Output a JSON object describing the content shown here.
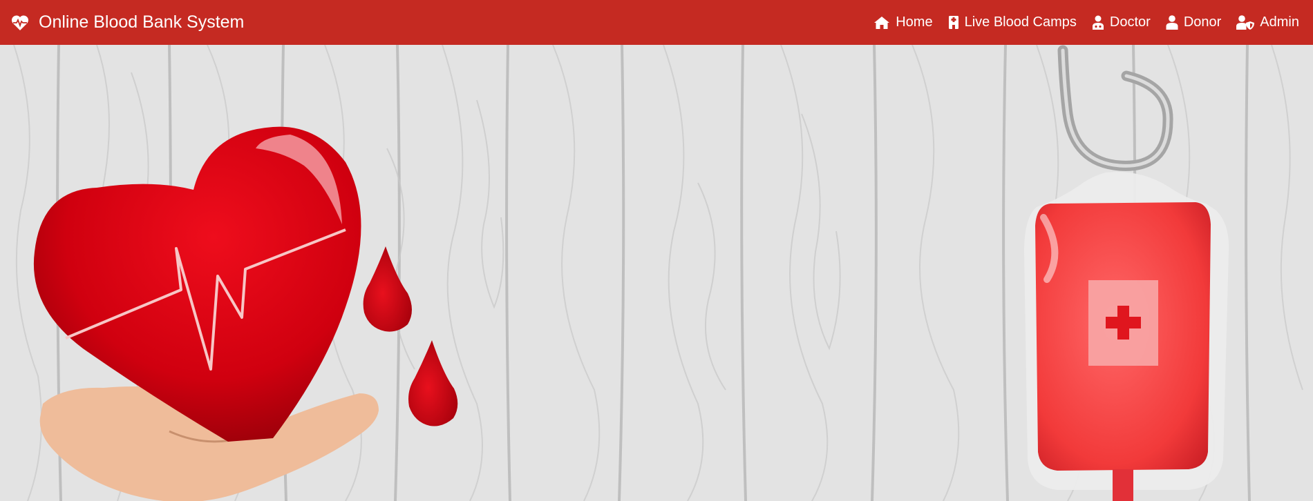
{
  "navbar": {
    "brand_icon": "heartbeat-icon",
    "brand_title": "Online Blood Bank System",
    "background_color": "#c52a22",
    "links": [
      {
        "label": "Home",
        "icon": "home-icon"
      },
      {
        "label": "Live Blood Camps",
        "icon": "hospital-icon"
      },
      {
        "label": "Doctor",
        "icon": "user-doctor-icon"
      },
      {
        "label": "Donor",
        "icon": "user-icon"
      },
      {
        "label": "Admin",
        "icon": "user-shield-icon"
      }
    ]
  },
  "hero": {
    "illustrations": [
      "heart-in-hand",
      "blood-drop",
      "blood-drop",
      "blood-bag"
    ],
    "background": "light-gray-wood-texture"
  }
}
